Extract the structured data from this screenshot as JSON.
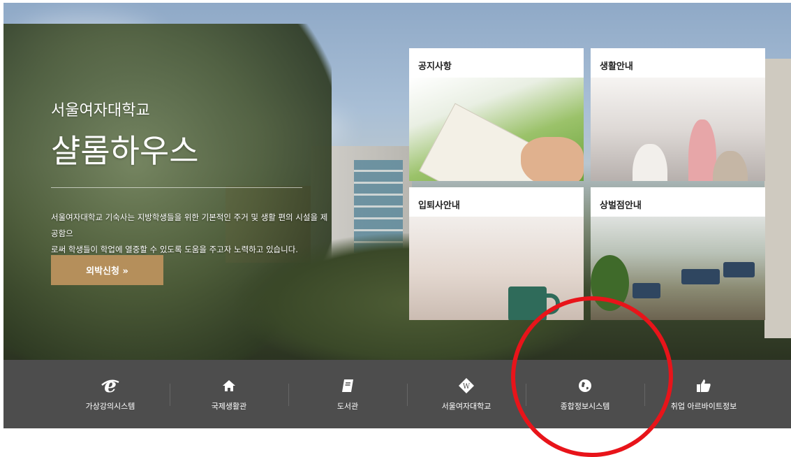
{
  "hero": {
    "subtitle": "서울여자대학교",
    "title": "샬롬하우스",
    "description_line1": "서울여자대학교 기숙사는 지방학생들을 위한 기본적인 주거 및 생활 편의 시설을 제공함으",
    "description_line2": "로써 학생들이 학업에 열중할 수 있도록 도움을 주고자 노력하고 있습니다.",
    "cta_label": "외박신청 »"
  },
  "cards": [
    {
      "title": "공지사항"
    },
    {
      "title": "생활안내"
    },
    {
      "title": "입퇴사안내"
    },
    {
      "title": "상벌점안내"
    }
  ],
  "quick_links": [
    {
      "label": "가상강의시스템",
      "icon": "ie-icon"
    },
    {
      "label": "국제생활관",
      "icon": "home-icon"
    },
    {
      "label": "도서관",
      "icon": "book-icon"
    },
    {
      "label": "서울여자대학교",
      "icon": "university-logo-icon"
    },
    {
      "label": "종합정보시스템",
      "icon": "globe-icon"
    },
    {
      "label": "취업 아르바이트정보",
      "icon": "thumbs-up-icon"
    }
  ],
  "colors": {
    "cta": "#b58f5b",
    "bar": "#4d4d4d",
    "annotation_circle": "#e8141a"
  }
}
